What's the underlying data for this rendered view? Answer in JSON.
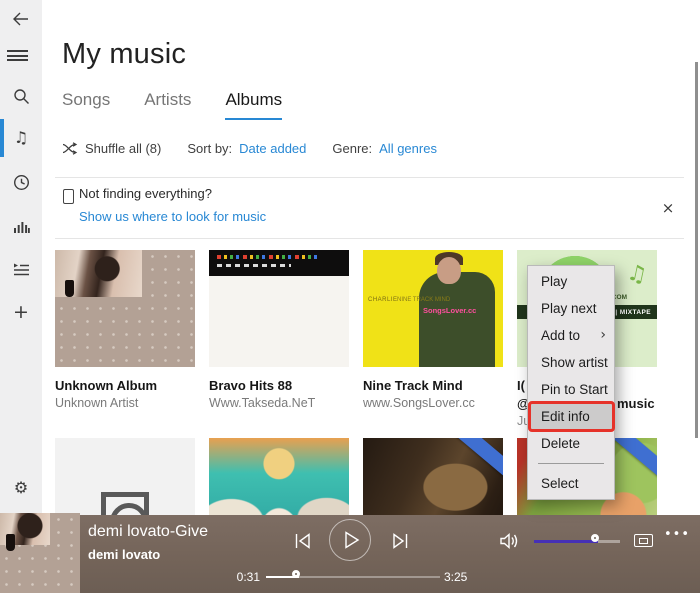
{
  "icons": {
    "minimize": "−",
    "maximize": "□",
    "close": "×",
    "music_note": "♫",
    "plus": "+",
    "gear": "⚙",
    "chevron_right": "›",
    "ellipsis": "•••"
  },
  "header": {
    "title": "My music"
  },
  "tabs": {
    "items": [
      {
        "label": "Songs"
      },
      {
        "label": "Artists"
      },
      {
        "label": "Albums"
      }
    ],
    "active": "Albums"
  },
  "filters": {
    "shuffle_label": "Shuffle all (8)",
    "sort_label": "Sort by:",
    "sort_value": "Date added",
    "genre_label": "Genre:",
    "genre_value": "All genres"
  },
  "banner": {
    "title": "Not finding everything?",
    "link_text": "Show us where to look for music"
  },
  "albums": {
    "items": [
      {
        "title": "Unknown Album",
        "subtitle": "Unknown Artist"
      },
      {
        "title": "Bravo Hits 88",
        "subtitle": "Www.Takseda.NeT"
      },
      {
        "title": "Nine Track Mind",
        "subtitle": "www.SongsLover.cc",
        "art_texts": {
          "left": "CHARLIE",
          "right": "NINE TRACK MIND",
          "pink": "SongsLover.cc"
        }
      },
      {
        "title_line1": "I(",
        "title_line2_left": "@",
        "title_line2_right": "music",
        "subtitle": "Ju",
        "art_texts": {
          "com": ".COM",
          "banner": "ENT | MIXTAPE"
        }
      }
    ]
  },
  "context_menu": {
    "items": [
      "Play",
      "Play next",
      "Add to",
      "Show artist",
      "Pin to Start",
      "Edit info",
      "Delete",
      "Select"
    ],
    "highlighted_item": "Edit info"
  },
  "player": {
    "track_title": "demi lovato-Give",
    "artist": "demi lovato",
    "elapsed": "0:31",
    "duration": "3:25"
  },
  "colors": {
    "accent_blue": "#2888d4",
    "highlight_red": "#e63229",
    "volume_fill": "#4630b6",
    "ribbon_blue": "#3f6fd1",
    "player_bar": "#74655b",
    "sidebar_bg": "#efeff0",
    "menu_bg": "#e9e7e8"
  }
}
